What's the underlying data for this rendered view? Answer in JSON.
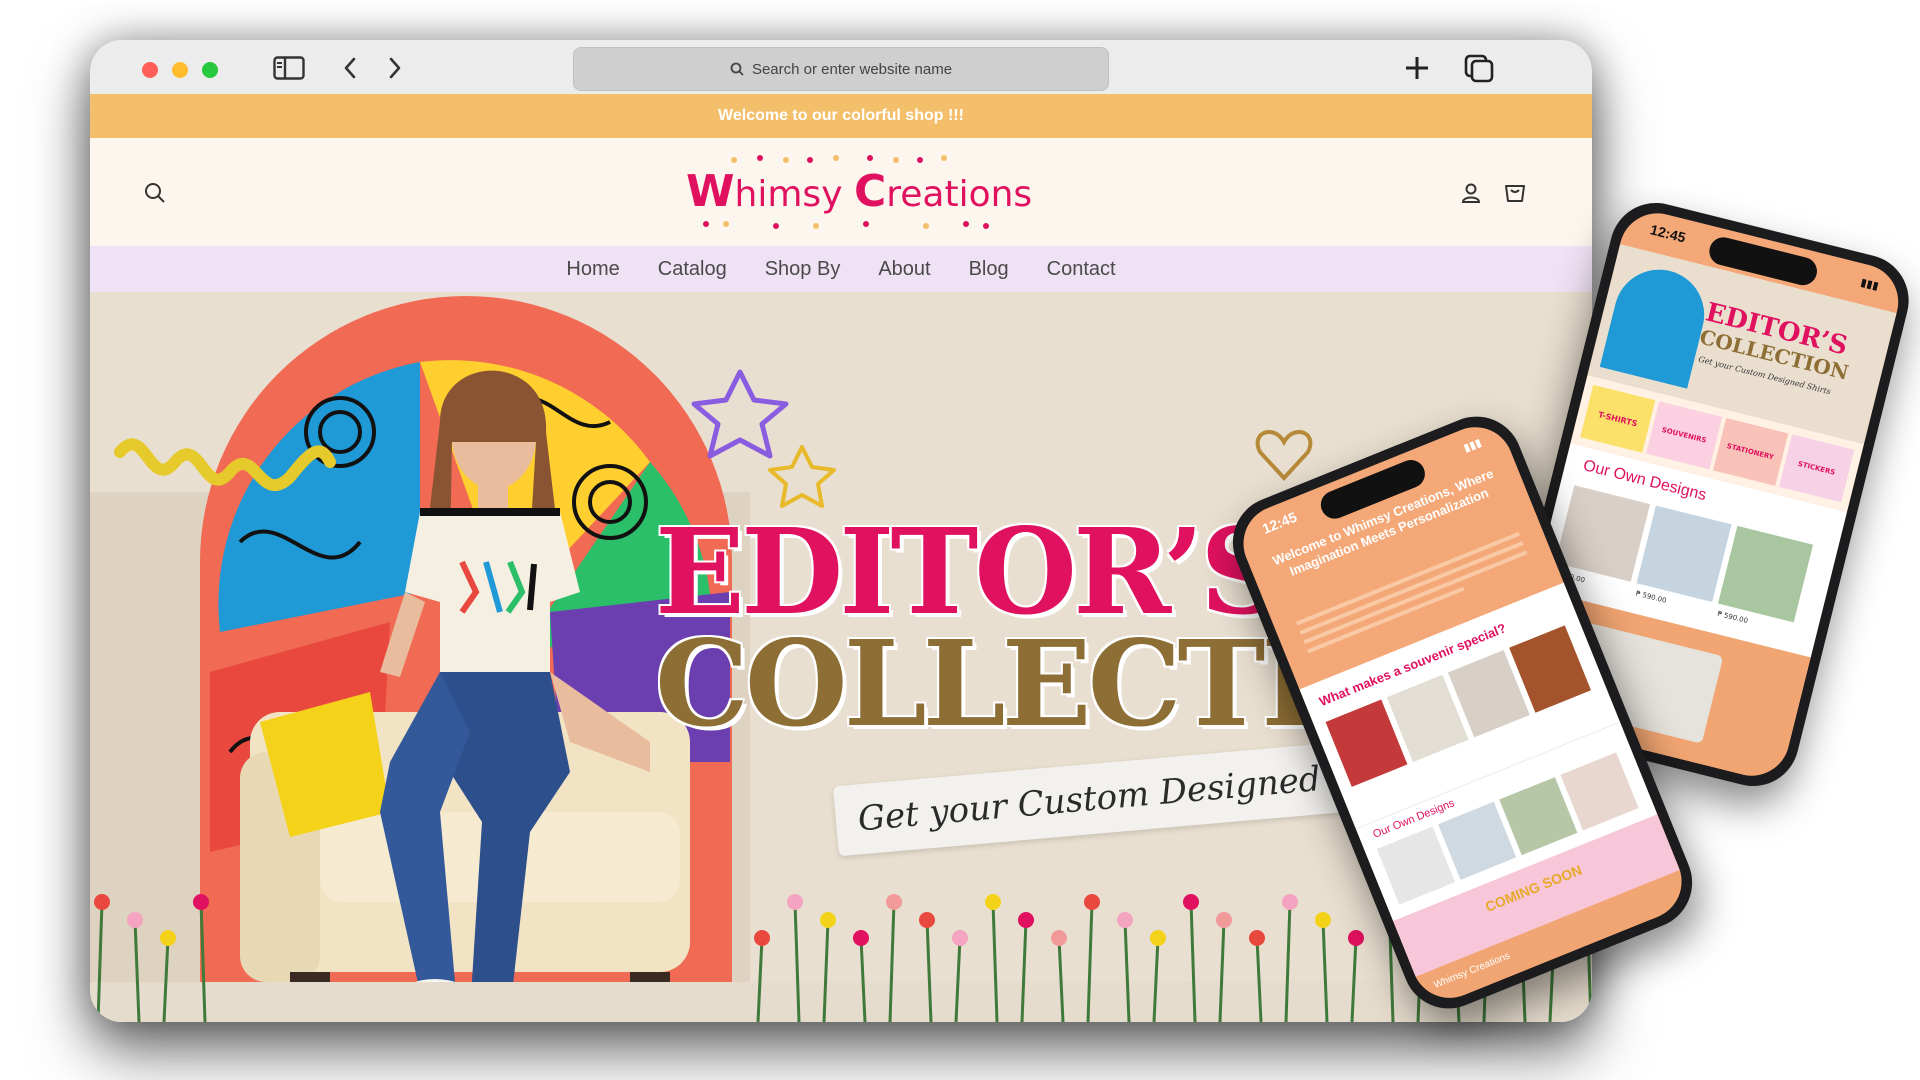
{
  "browser": {
    "search_placeholder": "Search or enter website name",
    "traffic_lights": [
      "#ff5f57",
      "#febc2e",
      "#28c840"
    ],
    "icons": [
      "sidebar-icon",
      "back-icon",
      "forward-icon",
      "new-tab-icon",
      "tabs-overview-icon"
    ]
  },
  "site": {
    "announcement": "Welcome to our colorful shop !!!",
    "logo": {
      "first_cap": "W",
      "first_rest": "himsy",
      "second_cap": "C",
      "second_rest": "reations"
    },
    "nav": [
      "Home",
      "Catalog",
      "Shop By",
      "About",
      "Blog",
      "Contact"
    ],
    "header_icons": [
      "search-icon",
      "account-icon",
      "cart-icon"
    ],
    "colors": {
      "announcement": "#f4bf6b",
      "nav": "#efe2f4",
      "brand_pink": "#e0115f",
      "brand_gold": "#8d6e35"
    }
  },
  "hero": {
    "title_line1": "EDITOR’S",
    "title_line2": "COLLECTIO",
    "subtitle": "Get your Custom Designed Shir"
  },
  "phone_back": {
    "time": "12:45",
    "hero_title_1": "EDITOR’S",
    "hero_title_2": "COLLECTION",
    "hero_sub": "Get your Custom Designed Shirts",
    "categories": [
      "T-SHIRTS",
      "SOUVENIRS",
      "STATIONERY",
      "STICKERS"
    ],
    "section": "Our Own Designs",
    "prices": [
      "₱ 590.00",
      "₱ 590.00",
      "₱ 590.00"
    ]
  },
  "phone_front": {
    "time": "12:45",
    "welcome": "Welcome to Whimsy Creations, Where Imagination Meets Personalization",
    "souvenir_title": "What makes a souvenir special?",
    "section": "Our Own Designs",
    "coming_soon": "COMING SOON",
    "footer_logo": "Whimsy Creations"
  }
}
